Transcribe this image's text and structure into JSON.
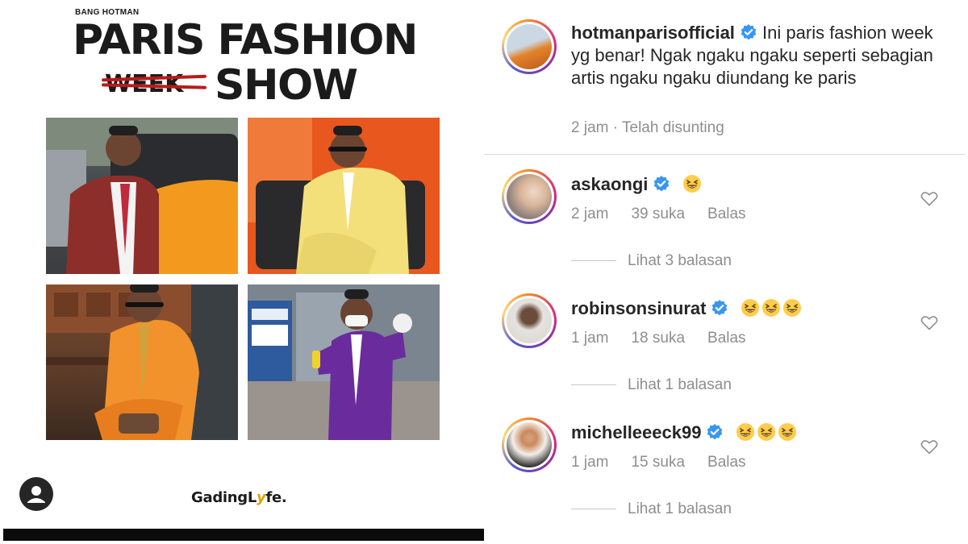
{
  "post": {
    "subtitle": "BANG HOTMAN",
    "title_line1": "PARIS FASHION",
    "struck_word": "WEEK",
    "title_word2": "SHOW",
    "brand_prefix": "GadingL",
    "brand_y": "y",
    "brand_suffix": "fe."
  },
  "caption": {
    "username": "hotmanparisofficial",
    "text": "Ini paris fashion week yg benar! Ngak ngaku ngaku seperti sebagian artis ngaku ngaku diundang ke paris",
    "time": "2 jam",
    "separator": "·",
    "edited": "Telah disunting"
  },
  "comments": [
    {
      "username": "askaongi",
      "emoji_count": 1,
      "time": "2 jam",
      "likes": "39 suka",
      "reply": "Balas",
      "view_replies": "Lihat 3 balasan"
    },
    {
      "username": "robinsonsinurat",
      "emoji_count": 3,
      "time": "1 jam",
      "likes": "18 suka",
      "reply": "Balas",
      "view_replies": "Lihat 1 balasan"
    },
    {
      "username": "michelleeeck99",
      "emoji_count": 3,
      "time": "1 jam",
      "likes": "15 suka",
      "reply": "Balas",
      "view_replies": "Lihat 1 balasan"
    }
  ],
  "icons": {
    "verified": "verified-badge-icon",
    "heart": "heart-outline-icon",
    "emoji": "grinning-squinting-face",
    "profile": "person-icon"
  },
  "colors": {
    "verified": "#3897f0",
    "meta_text": "#8e8e8e",
    "strike": "#b81b1b"
  }
}
